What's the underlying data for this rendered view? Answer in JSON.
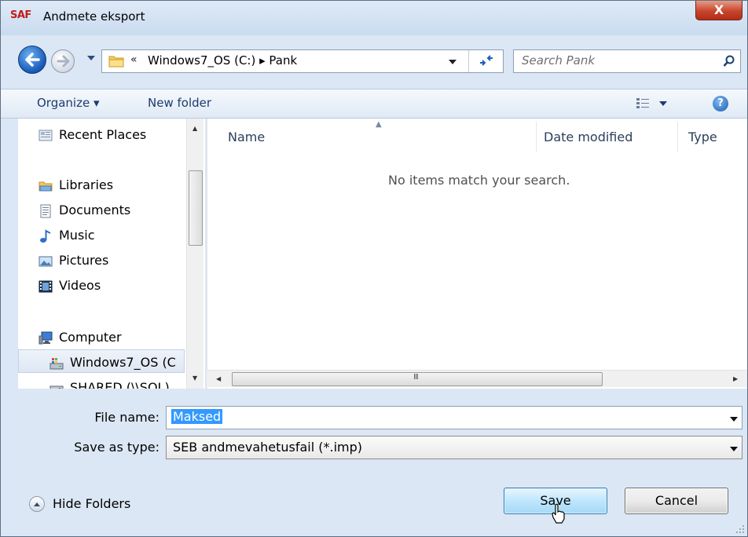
{
  "window": {
    "app_logo": "SAF",
    "title": "Andmete eksport",
    "close_glyph": "X"
  },
  "address_bar": {
    "chevron": "«",
    "path": "Windows7_OS (C:) ▸ Pank",
    "search_placeholder": "Search Pank"
  },
  "toolbar": {
    "organize_label": "Organize ▾",
    "new_folder_label": "New folder",
    "help_glyph": "?"
  },
  "nav_pane": {
    "items": [
      {
        "label": "Recent Places",
        "icon": "recent-places-icon"
      },
      {
        "label": "Libraries",
        "icon": "libraries-icon"
      },
      {
        "label": "Documents",
        "icon": "documents-icon"
      },
      {
        "label": "Music",
        "icon": "music-icon"
      },
      {
        "label": "Pictures",
        "icon": "pictures-icon"
      },
      {
        "label": "Videos",
        "icon": "videos-icon"
      },
      {
        "label": "Computer",
        "icon": "computer-icon"
      },
      {
        "label": "Windows7_OS (C",
        "icon": "drive-icon",
        "selected": true
      },
      {
        "label": "SHARED (\\\\SQL)",
        "icon": "network-drive-icon"
      }
    ]
  },
  "file_list": {
    "columns": [
      "Name",
      "Date modified",
      "Type"
    ],
    "empty_message": "No items match your search.",
    "h_scroll_grip": "III"
  },
  "form": {
    "file_name_label": "File name:",
    "file_name_value": "Maksed",
    "save_type_label": "Save as type:",
    "save_type_value": "SEB andmevahetusfail (*.imp)"
  },
  "footer": {
    "hide_folders_label": "Hide Folders",
    "save_label": "Save",
    "cancel_label": "Cancel"
  },
  "colors": {
    "window_bg": "#dbe7f4",
    "close_red": "#c7452c",
    "selection_blue": "#3399ff",
    "save_button_blue": "#bee6fd"
  }
}
